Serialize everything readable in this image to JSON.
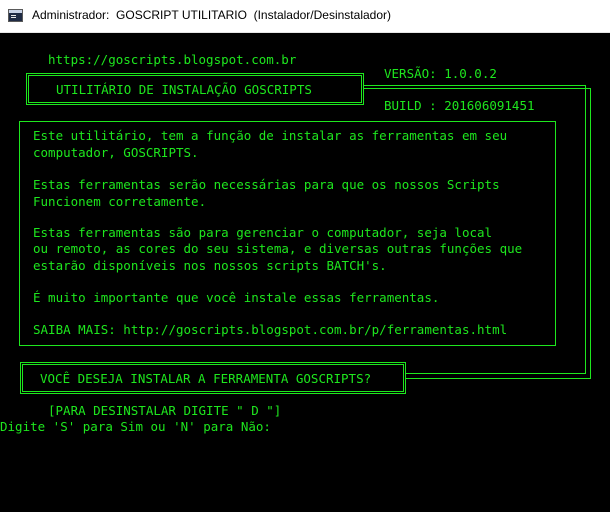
{
  "window": {
    "title": "Administrador:  GOSCRIPT UTILITARIO  (Instalador/Desinstalador)",
    "icon": "console-window-icon"
  },
  "console": {
    "text_color": "#1ee71e",
    "background": "#000000",
    "url": "https://goscripts.blogspot.com.br",
    "header_title": "UTILITÁRIO DE INSTALAÇÃO GOSCRIPTS",
    "version": "VERSÃO: 1.0.0.2",
    "build": "BUILD : 201606091451",
    "info_lines": [
      "Este utilitário, tem a função de instalar as ferramentas em seu",
      "computador, GOSCRIPTS.",
      "Estas ferramentas serão necessárias para que os nossos Scripts",
      "Funcionem corretamente.",
      "Estas ferramentas são para gerenciar o computador, seja local",
      "ou remoto, as cores do seu sistema, e diversas outras funções que",
      "estarão disponíveis nos nossos scripts BATCH's.",
      "É muito importante que você instale essas ferramentas.",
      "SAIBA MAIS: http://goscripts.blogspot.com.br/p/ferramentas.html"
    ],
    "question": "VOCÊ DESEJA INSTALAR A FERRAMENTA GOSCRIPTS?",
    "uninstall_hint": "[PARA DESINSTALAR DIGITE \" D \"]",
    "prompt": "Digite 'S' para Sim ou 'N' para Não:"
  }
}
